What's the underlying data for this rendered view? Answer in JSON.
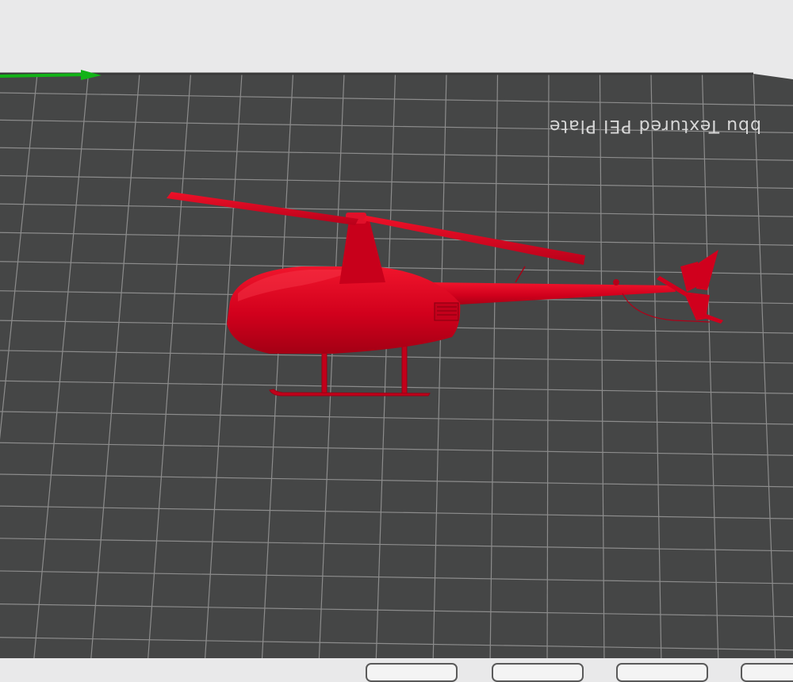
{
  "viewport": {
    "background_color": "#e9e9ea",
    "plate": {
      "label": "bbu Textured PEI Plate",
      "surface_color": "#454646",
      "grid_color": "#8c8c8c",
      "edge_color": "#3a3a3a"
    },
    "axis": {
      "name": "x-axis",
      "color": "#12b317"
    },
    "model": {
      "name": "helicopter",
      "color": "#d0001d"
    }
  },
  "bottom_toolbar": {
    "tabs": [
      {
        "name": "toolbar-tab-1"
      },
      {
        "name": "toolbar-tab-2"
      },
      {
        "name": "toolbar-tab-3"
      },
      {
        "name": "toolbar-tab-4"
      }
    ]
  }
}
